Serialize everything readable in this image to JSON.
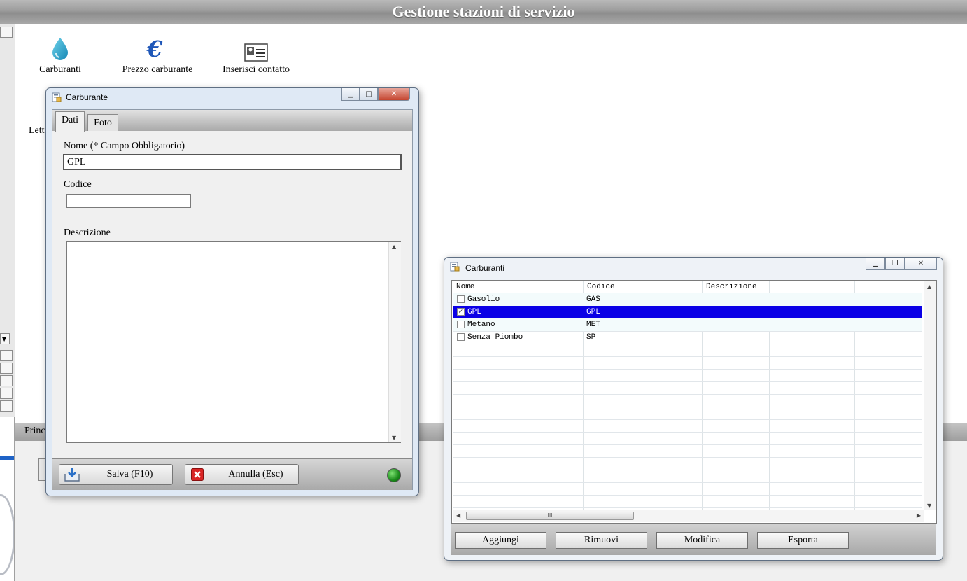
{
  "app": {
    "title": "Gestione stazioni di servizio",
    "toolbar": [
      {
        "label": "Carburanti",
        "icon": "drop-icon"
      },
      {
        "label": "Prezzo carburante",
        "icon": "euro-icon"
      },
      {
        "label": "Inserisci contatto",
        "icon": "contact-card-icon"
      }
    ],
    "partial_labels": {
      "lett": "Lett",
      "princ": "Princ"
    }
  },
  "dialog": {
    "title": "Carburante",
    "tabs": [
      "Dati",
      "Foto"
    ],
    "fields": {
      "nome_label": "Nome (* Campo Obbligatorio)",
      "nome_value": "GPL",
      "codice_label": "Codice",
      "codice_value": "",
      "descrizione_label": "Descrizione",
      "descrizione_value": ""
    },
    "buttons": {
      "save": "Salva (F10)",
      "cancel": "Annulla (Esc)"
    },
    "status_color": "#1a8a1a"
  },
  "list_window": {
    "title": "Carburanti",
    "columns": [
      "Nome",
      "Codice",
      "Descrizione"
    ],
    "rows": [
      {
        "nome": "Gasolio",
        "codice": "GAS",
        "checked": false,
        "selected": false
      },
      {
        "nome": "GPL",
        "codice": "GPL",
        "checked": true,
        "selected": true
      },
      {
        "nome": "Metano",
        "codice": "MET",
        "checked": false,
        "selected": false
      },
      {
        "nome": "Senza Piombo",
        "codice": "SP",
        "checked": false,
        "selected": false
      }
    ],
    "buttons": [
      "Aggiungi",
      "Rimuovi",
      "Modifica",
      "Esporta"
    ],
    "selection_color": "#0a00e6"
  }
}
